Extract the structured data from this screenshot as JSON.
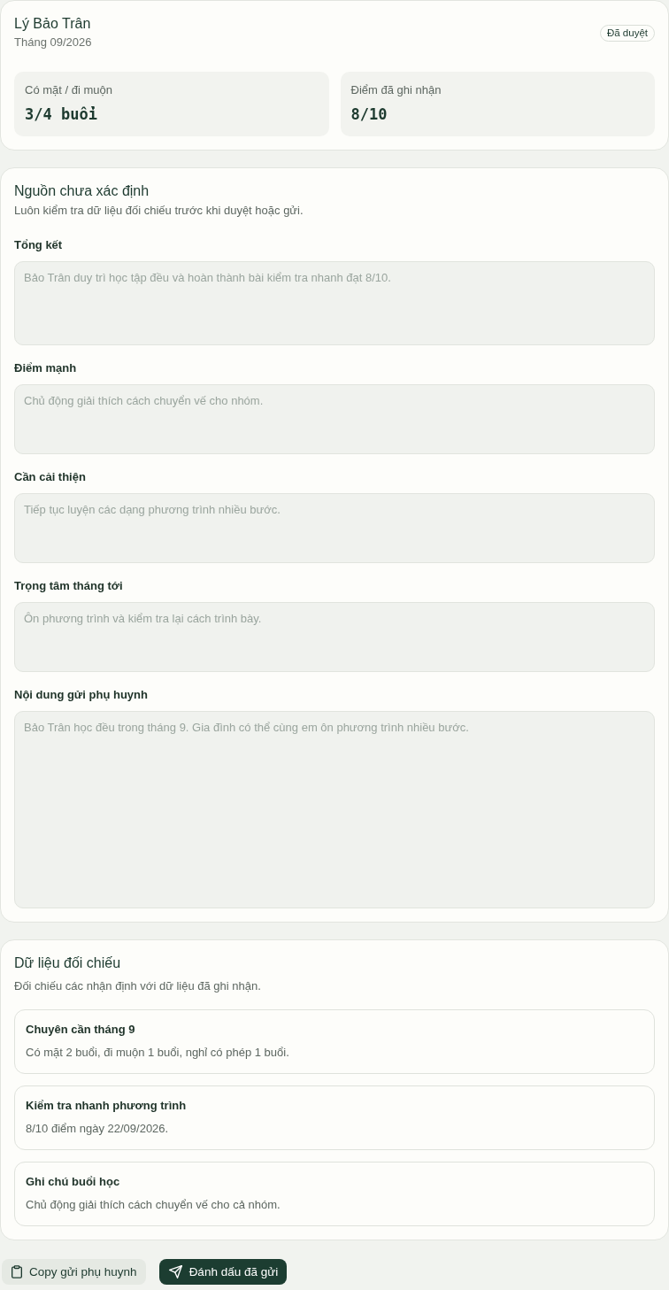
{
  "student": {
    "name": "Lý Bảo Trân",
    "period": "Tháng 09/2026",
    "status": "Đã duyệt"
  },
  "stats": [
    {
      "label": "Có mặt / đi muộn",
      "value": "3/4 buổi"
    },
    {
      "label": "Điểm đã ghi nhận",
      "value": "8/10"
    }
  ],
  "report": {
    "title": "Nguồn chưa xác định",
    "description": "Luôn kiểm tra dữ liệu đối chiếu trước khi duyệt hoặc gửi.",
    "fields": [
      {
        "label": "Tổng kết",
        "placeholder": "Bảo Trân duy trì học tập đều và hoàn thành bài kiểm tra nhanh đạt 8/10."
      },
      {
        "label": "Điểm mạnh",
        "placeholder": "Chủ động giải thích cách chuyển vế cho nhóm."
      },
      {
        "label": "Cần cải thiện",
        "placeholder": "Tiếp tục luyện các dạng phương trình nhiều bước."
      },
      {
        "label": "Trọng tâm tháng tới",
        "placeholder": "Ôn phương trình và kiểm tra lại cách trình bày."
      },
      {
        "label": "Nội dung gửi phụ huynh",
        "placeholder": "Bảo Trân học đều trong tháng 9. Gia đình có thể cùng em ôn phương trình nhiều bước."
      }
    ]
  },
  "evidence": {
    "title": "Dữ liệu đối chiếu",
    "description": "Đối chiếu các nhận định với dữ liệu đã ghi nhận.",
    "items": [
      {
        "title": "Chuyên cần tháng 9",
        "detail": "Có mặt 2 buổi, đi muộn 1 buổi, nghỉ có phép 1 buổi."
      },
      {
        "title": "Kiểm tra nhanh phương trình",
        "detail": "8/10 điểm ngày 22/09/2026."
      },
      {
        "title": "Ghi chú buổi học",
        "detail": "Chủ động giải thích cách chuyển vế cho cả nhóm."
      }
    ]
  },
  "actions": [
    {
      "label": "Copy gửi phụ huynh",
      "kind": "secondary"
    },
    {
      "label": "Đánh dấu đã gửi",
      "kind": "primary"
    }
  ]
}
